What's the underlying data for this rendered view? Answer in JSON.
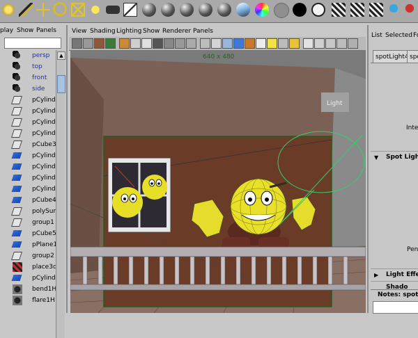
{
  "outliner": {
    "menu": [
      "play",
      "Show",
      "Panels"
    ],
    "items": [
      {
        "label": "persp",
        "icon": "camera-icon",
        "kind": "camera"
      },
      {
        "label": "top",
        "icon": "camera-icon",
        "kind": "camera"
      },
      {
        "label": "front",
        "icon": "camera-icon",
        "kind": "camera"
      },
      {
        "label": "side",
        "icon": "camera-icon",
        "kind": "camera"
      },
      {
        "label": "pCylinde",
        "icon": "transform-icon",
        "kind": "node"
      },
      {
        "label": "pCylinde",
        "icon": "transform-icon",
        "kind": "node"
      },
      {
        "label": "pCylinde",
        "icon": "transform-icon",
        "kind": "node"
      },
      {
        "label": "pCylinde",
        "icon": "transform-icon",
        "kind": "node"
      },
      {
        "label": "pCube3",
        "icon": "transform-icon",
        "kind": "node"
      },
      {
        "label": "pCylinde",
        "icon": "mesh-icon",
        "kind": "node"
      },
      {
        "label": "pCylinde",
        "icon": "mesh-icon",
        "kind": "node"
      },
      {
        "label": "pCylinde",
        "icon": "mesh-icon",
        "kind": "node"
      },
      {
        "label": "pCylinde",
        "icon": "mesh-icon",
        "kind": "node"
      },
      {
        "label": "pCube4",
        "icon": "mesh-icon",
        "kind": "node"
      },
      {
        "label": "polySurf",
        "icon": "transform-icon",
        "kind": "node"
      },
      {
        "label": "group1",
        "icon": "transform-icon",
        "kind": "node"
      },
      {
        "label": "pCube5",
        "icon": "mesh-icon",
        "kind": "node"
      },
      {
        "label": "pPlane1",
        "icon": "mesh-icon",
        "kind": "node"
      },
      {
        "label": "group2",
        "icon": "transform-icon",
        "kind": "node"
      },
      {
        "label": "place3d",
        "icon": "texture-icon",
        "kind": "node"
      },
      {
        "label": "pCylinde",
        "icon": "mesh-icon",
        "kind": "node"
      },
      {
        "label": "bend1H",
        "icon": "deformer-icon",
        "kind": "node"
      },
      {
        "label": "flare1H",
        "icon": "deformer-icon",
        "kind": "node"
      }
    ]
  },
  "panel": {
    "menu": [
      "View",
      "Shading",
      "Lighting",
      "Show",
      "Renderer",
      "Panels"
    ],
    "resolution_label": "640 x 480"
  },
  "attribute_editor": {
    "menu": [
      "List",
      "Selected",
      "Fo"
    ],
    "tabs": [
      "spotLight4",
      "spo"
    ],
    "field_labels": [
      "Inter",
      "Pen"
    ],
    "sections": [
      {
        "label": "Spot Light",
        "expanded": true
      },
      {
        "label": "Light Effe",
        "expanded": false
      },
      {
        "label": "Shado",
        "expanded": false
      }
    ],
    "notes_label": "Notes:",
    "notes_value": "spotL"
  },
  "shelf": {
    "tools": [
      "sun-icon",
      "wand-icon",
      "crosshair-move-icon",
      "rotate-icon",
      "scale-icon",
      "bulb-icon",
      "camera-icon",
      "graph-editor-icon",
      "sphere-icon",
      "sphere-icon",
      "sphere-icon",
      "sphere-icon",
      "sphere-icon",
      "ramp-sphere-icon",
      "color-sphere-icon",
      "gray-sphere-icon",
      "black-sphere-icon",
      "white-sphere-icon",
      "clapboard-icon",
      "clapboard-icon",
      "clapboard-icon",
      "render-icon",
      "render-icon"
    ]
  },
  "colors": {
    "accent": "#1b2cb4",
    "viewport_bg": "#7b7b7b",
    "wall": "#6a3c28",
    "resolution_gate": "#1f5f1f"
  }
}
